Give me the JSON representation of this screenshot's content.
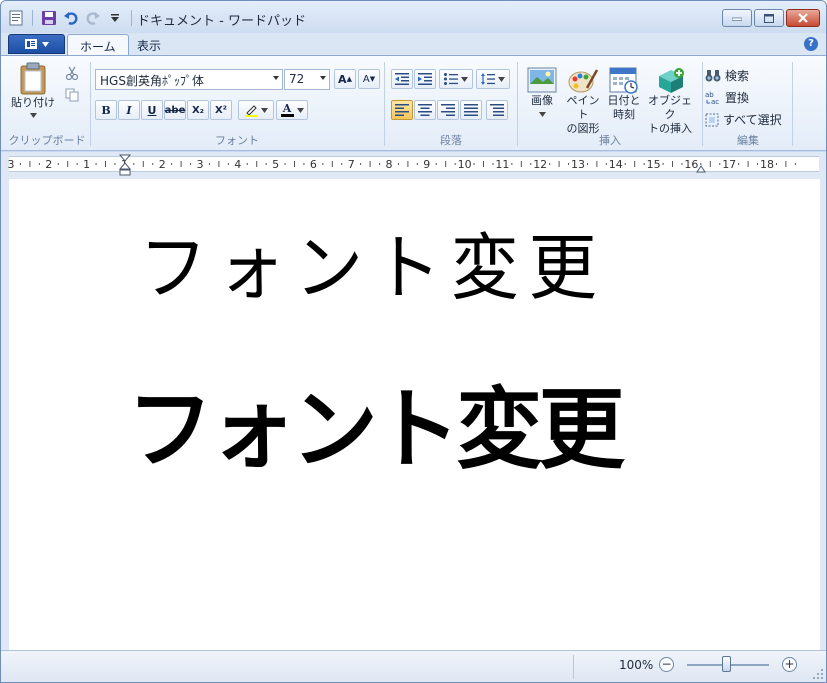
{
  "window": {
    "title": "ドキュメント - ワードパッド"
  },
  "tabs": [
    {
      "label": "ホーム",
      "active": true
    },
    {
      "label": "表示",
      "active": false
    }
  ],
  "ribbon": {
    "clipboard": {
      "paste_label": "貼り付け",
      "group_label": "クリップボード"
    },
    "font": {
      "font_name": "HGS創英角ﾎﾟｯﾌﾟ体",
      "font_size": "72",
      "grow_label": "A",
      "shrink_label": "A",
      "bold_label": "B",
      "italic_label": "I",
      "underline_label": "U",
      "strike_label": "abe",
      "subscript_label": "X₂",
      "superscript_label": "X²",
      "color_label": "A",
      "group_label": "フォント"
    },
    "paragraph": {
      "group_label": "段落"
    },
    "insert": {
      "image_label": "画像",
      "paint_label1": "ペイント",
      "paint_label2": "の図形",
      "datetime_label1": "日付と",
      "datetime_label2": "時刻",
      "object_label1": "オブジェク",
      "object_label2": "トの挿入",
      "group_label": "挿入"
    },
    "editing": {
      "find_label": "検索",
      "replace_label": "置換",
      "select_all_label": "すべて選択",
      "group_label": "編集"
    }
  },
  "ruler": {
    "numbers": [
      "3",
      "2",
      "1",
      "1",
      "2",
      "3",
      "4",
      "5",
      "6",
      "7",
      "8",
      "9",
      "10",
      "11",
      "12",
      "13",
      "14",
      "15",
      "16",
      "17",
      "18"
    ]
  },
  "document": {
    "line1": "フォント変更",
    "line2": "フォント変更"
  },
  "statusbar": {
    "zoom": "100%",
    "zoom_out": "−",
    "zoom_in": "+",
    "zoom_level": 1.0
  },
  "colors": {
    "accent": "#1c4ea4",
    "font_color_bar": "#000000",
    "highlight_color": "#ffff00"
  }
}
